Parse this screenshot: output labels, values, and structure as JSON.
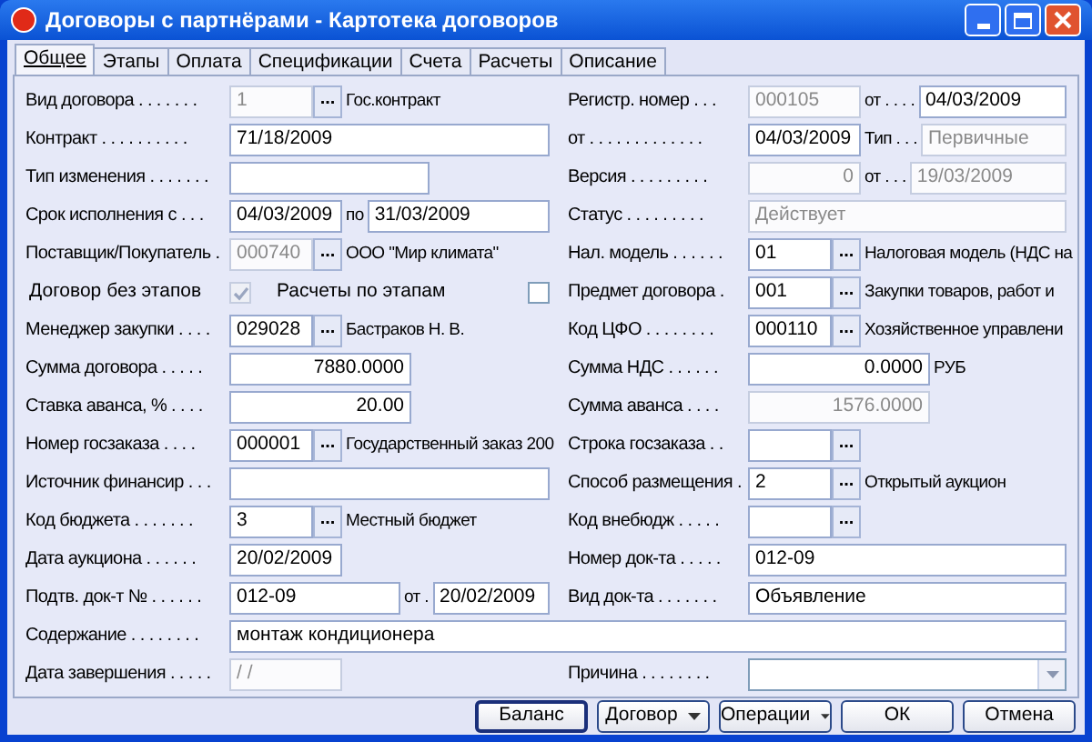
{
  "window": {
    "title": "Договоры с партнёрами - Картотека договоров"
  },
  "tabs": [
    {
      "label": "Общее",
      "selected": true
    },
    {
      "label": "Этапы",
      "selected": false
    },
    {
      "label": "Оплата",
      "selected": false
    },
    {
      "label": "Спецификации",
      "selected": false
    },
    {
      "label": "Счета",
      "selected": false
    },
    {
      "label": "Расчеты",
      "selected": false
    },
    {
      "label": "Описание",
      "selected": false
    }
  ],
  "rows": [
    {
      "left": {
        "label": "Вид договора . . . . . . .",
        "parts": [
          {
            "kind": "code_field",
            "value": "1",
            "disabled": true
          },
          {
            "kind": "lookup_button",
            "label": "..."
          },
          {
            "kind": "text",
            "text": "Гос.контракт"
          }
        ]
      },
      "right": {
        "label": "Регистр. номер . . .",
        "parts": [
          {
            "kind": "date_field",
            "value": "000105",
            "disabled": true
          },
          {
            "kind": "text",
            "text": "от . . . ."
          },
          {
            "kind": "wide_field",
            "value": "04/03/2009",
            "disabled": false
          }
        ]
      }
    },
    {
      "left": {
        "label": "Контракт . . . . . . . . . .",
        "parts": [
          {
            "kind": "wide_field",
            "value": "71/18/2009",
            "disabled": false
          }
        ]
      },
      "right": {
        "label": "от . . . . . . . . . . . . .",
        "parts": [
          {
            "kind": "date_field",
            "value": "04/03/2009",
            "disabled": false
          },
          {
            "kind": "text",
            "text": "Тип . . ."
          },
          {
            "kind": "wide_field",
            "value": "Первичные",
            "disabled": true
          }
        ]
      }
    },
    {
      "left": {
        "label": "Тип изменения . . . . . . .",
        "parts": [
          {
            "kind": "medium_field",
            "disabled": false
          }
        ]
      },
      "right": {
        "label": "Версия . . . . . . . . .",
        "parts": [
          {
            "kind": "short_number_field",
            "value": "0",
            "disabled": true
          },
          {
            "kind": "text",
            "text": "от . . ."
          },
          {
            "kind": "wide_field",
            "value": "19/03/2009",
            "disabled": true
          }
        ]
      }
    },
    {
      "left": {
        "label": "Срок исполнения с . . .",
        "parts": [
          {
            "kind": "date_field",
            "value": "04/03/2009",
            "disabled": false
          },
          {
            "kind": "text",
            "text": "по"
          },
          {
            "kind": "wide_field",
            "value": "31/03/2009",
            "disabled": false
          }
        ]
      },
      "right": {
        "label": "Статус . . . . . . . . .",
        "parts": [
          {
            "kind": "wide_field",
            "value": "Действует",
            "disabled": true
          }
        ]
      }
    },
    {
      "left": {
        "label": "Поставщик/Покупатель .",
        "parts": [
          {
            "kind": "code_field",
            "value": "000740",
            "disabled": true
          },
          {
            "kind": "lookup_button",
            "label": "..."
          },
          {
            "kind": "text",
            "text": "ООО \"Мир климата\""
          }
        ]
      },
      "right": {
        "label": "Нал. модель . . . . . .",
        "parts": [
          {
            "kind": "code_field",
            "value": "01",
            "disabled": false
          },
          {
            "kind": "lookup_button",
            "label": "..."
          },
          {
            "kind": "text",
            "text": "Налоговая модель (НДС на"
          }
        ]
      }
    },
    {
      "left": {
        "parts": [
          {
            "kind": "checkbox",
            "label": "Договор без этапов",
            "checked": true,
            "disabled": true
          },
          {
            "kind": "checkbox",
            "label": "Расчеты по этапам",
            "checked": false,
            "disabled": false
          }
        ]
      },
      "right": {
        "label": "Предмет договора .",
        "parts": [
          {
            "kind": "code_field",
            "value": "001",
            "disabled": false
          },
          {
            "kind": "lookup_button",
            "label": "..."
          },
          {
            "kind": "text",
            "text": "Закупки товаров, работ и"
          }
        ]
      }
    },
    {
      "left": {
        "label": "Менеджер закупки . . . .",
        "parts": [
          {
            "kind": "code_field",
            "value": "029028",
            "disabled": false
          },
          {
            "kind": "lookup_button",
            "label": "..."
          },
          {
            "kind": "text",
            "text": "Бастраков Н. В."
          }
        ]
      },
      "right": {
        "label": "Код ЦФО . . . . . . . .",
        "parts": [
          {
            "kind": "code_field",
            "value": "000110",
            "disabled": false
          },
          {
            "kind": "lookup_button",
            "label": "..."
          },
          {
            "kind": "text",
            "text": "Хозяйственное управлени"
          }
        ]
      }
    },
    {
      "left": {
        "label": "Сумма договора . . . . .",
        "parts": [
          {
            "kind": "number_field",
            "value": "7880.0000",
            "disabled": false
          }
        ]
      },
      "right": {
        "label": "Сумма НДС . . . . . .",
        "parts": [
          {
            "kind": "number_field",
            "value": "0.0000",
            "disabled": false
          },
          {
            "kind": "text",
            "text": "РУБ"
          }
        ]
      }
    },
    {
      "left": {
        "label": "Ставка аванса, % . . . .",
        "parts": [
          {
            "kind": "number_field",
            "value": "20.00",
            "disabled": false
          }
        ]
      },
      "right": {
        "label": "Сумма аванса . . . .",
        "parts": [
          {
            "kind": "number_field",
            "value": "1576.0000",
            "disabled": true
          }
        ]
      }
    },
    {
      "left": {
        "label": "Номер госзаказа . . . .",
        "parts": [
          {
            "kind": "code_field",
            "value": "000001",
            "disabled": false
          },
          {
            "kind": "lookup_button",
            "label": "..."
          },
          {
            "kind": "text",
            "text": "Государственный заказ 200"
          }
        ]
      },
      "right": {
        "label": "Строка госзаказа . .",
        "parts": [
          {
            "kind": "code_field",
            "disabled": false
          },
          {
            "kind": "lookup_button",
            "label": "..."
          }
        ]
      }
    },
    {
      "left": {
        "label": "Источник финансир . . .",
        "parts": [
          {
            "kind": "wide_field",
            "disabled": false
          }
        ]
      },
      "right": {
        "label": "Способ размещения .",
        "parts": [
          {
            "kind": "code_field",
            "value": "2",
            "disabled": false
          },
          {
            "kind": "lookup_button",
            "label": "..."
          },
          {
            "kind": "text",
            "text": "Открытый аукцион"
          }
        ]
      }
    },
    {
      "left": {
        "label": "Код бюджета . . . . . . .",
        "parts": [
          {
            "kind": "code_field",
            "value": "3",
            "disabled": false
          },
          {
            "kind": "lookup_button",
            "label": "..."
          },
          {
            "kind": "text",
            "text": "Местный бюджет"
          }
        ]
      },
      "right": {
        "label": "Код внебюдж . . . . .",
        "parts": [
          {
            "kind": "code_field",
            "disabled": false
          },
          {
            "kind": "lookup_button",
            "label": "..."
          }
        ]
      }
    },
    {
      "left": {
        "label": "Дата аукциона . . . . . .",
        "parts": [
          {
            "kind": "date_field",
            "value": "20/02/2009",
            "disabled": false
          }
        ]
      },
      "right": {
        "label": "Номер док-та . . . . .",
        "parts": [
          {
            "kind": "wide_field",
            "value": "012-09",
            "disabled": false
          }
        ]
      }
    },
    {
      "left": {
        "label": "Подтв. док-т № . . . . . .",
        "parts": [
          {
            "kind": "text_field",
            "value": "012-09",
            "disabled": false
          },
          {
            "kind": "text",
            "text": "от ."
          },
          {
            "kind": "wide_field",
            "value": "20/02/2009",
            "disabled": false
          }
        ]
      },
      "right": {
        "label": "Вид док-та . . . . . . .",
        "parts": [
          {
            "kind": "wide_field",
            "value": "Объявление",
            "disabled": false
          }
        ]
      }
    },
    {
      "full": {
        "label": "Содержание . . . . . . . .",
        "parts": [
          {
            "kind": "wide_field",
            "value": "монтаж кондиционера",
            "disabled": false
          }
        ]
      }
    },
    {
      "left": {
        "label": "Дата завершения . . . . .",
        "parts": [
          {
            "kind": "date_field",
            "value": "  /  /",
            "disabled": true
          }
        ]
      },
      "right": {
        "label": "Причина . . . . . . . .",
        "parts": [
          {
            "kind": "select_field",
            "disabled": false
          }
        ]
      }
    }
  ],
  "buttons": [
    {
      "label": "Баланс",
      "kind": "plain",
      "default": true
    },
    {
      "label": "Договор",
      "kind": "menu",
      "default": false
    },
    {
      "label": "Операции",
      "kind": "menu",
      "default": false
    },
    {
      "label": "ОК",
      "kind": "plain",
      "default": false
    },
    {
      "label": "Отмена",
      "kind": "plain",
      "default": false
    }
  ]
}
